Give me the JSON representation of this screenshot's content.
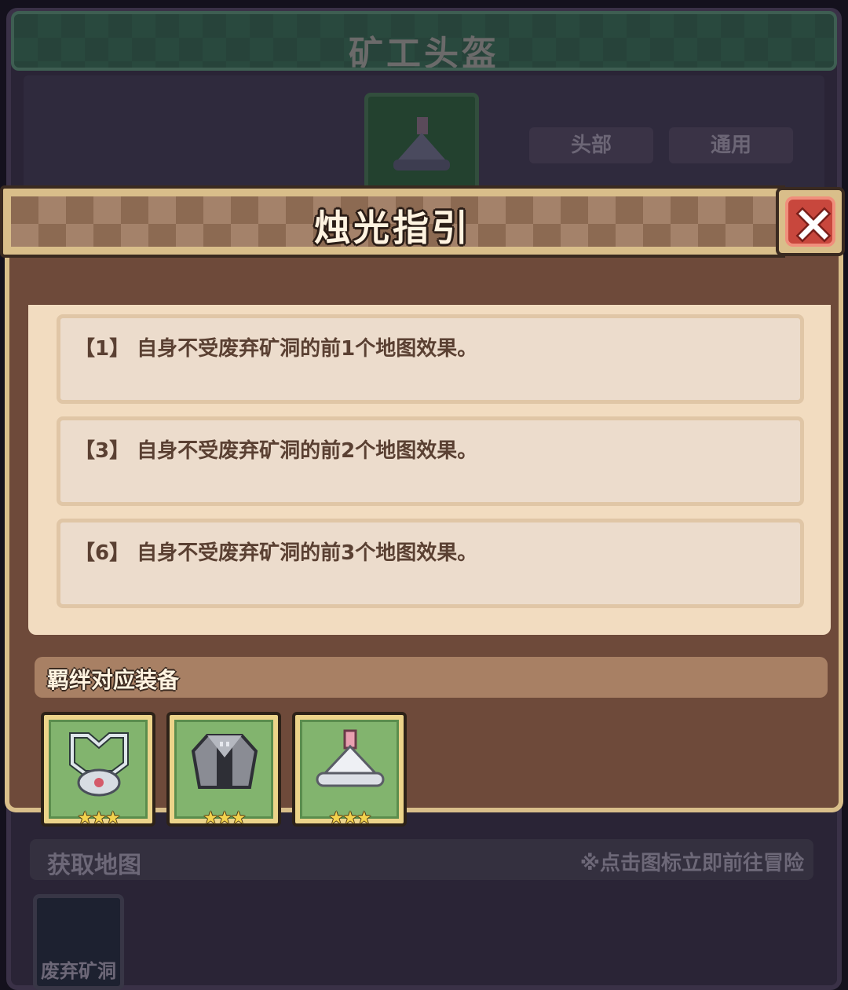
{
  "background": {
    "item_name": "矿工头盔",
    "tags": [
      "头部",
      "通用"
    ],
    "map_section_title": "获取地图",
    "map_section_hint": "※点击图标立即前往冒险",
    "map_tile_label": "废弃矿洞"
  },
  "modal": {
    "title": "烛光指引",
    "effects": [
      {
        "text": "【1】 自身不受废弃矿洞的前1个地图效果。"
      },
      {
        "text": "【3】 自身不受废弃矿洞的前2个地图效果。"
      },
      {
        "text": "【6】 自身不受废弃矿洞的前3个地图效果。"
      }
    ],
    "bond_title": "羁绊对应装备",
    "equipment": [
      {
        "icon": "necklace-icon",
        "stars": "★★★"
      },
      {
        "icon": "coat-icon",
        "stars": "★★★"
      },
      {
        "icon": "miner-helmet-icon",
        "stars": "★★★"
      }
    ]
  },
  "colors": {
    "modal_frame": "#d9be8a",
    "modal_body": "#6e4a3a",
    "close_red": "#c8473d",
    "equip_green": "#82b46e"
  }
}
